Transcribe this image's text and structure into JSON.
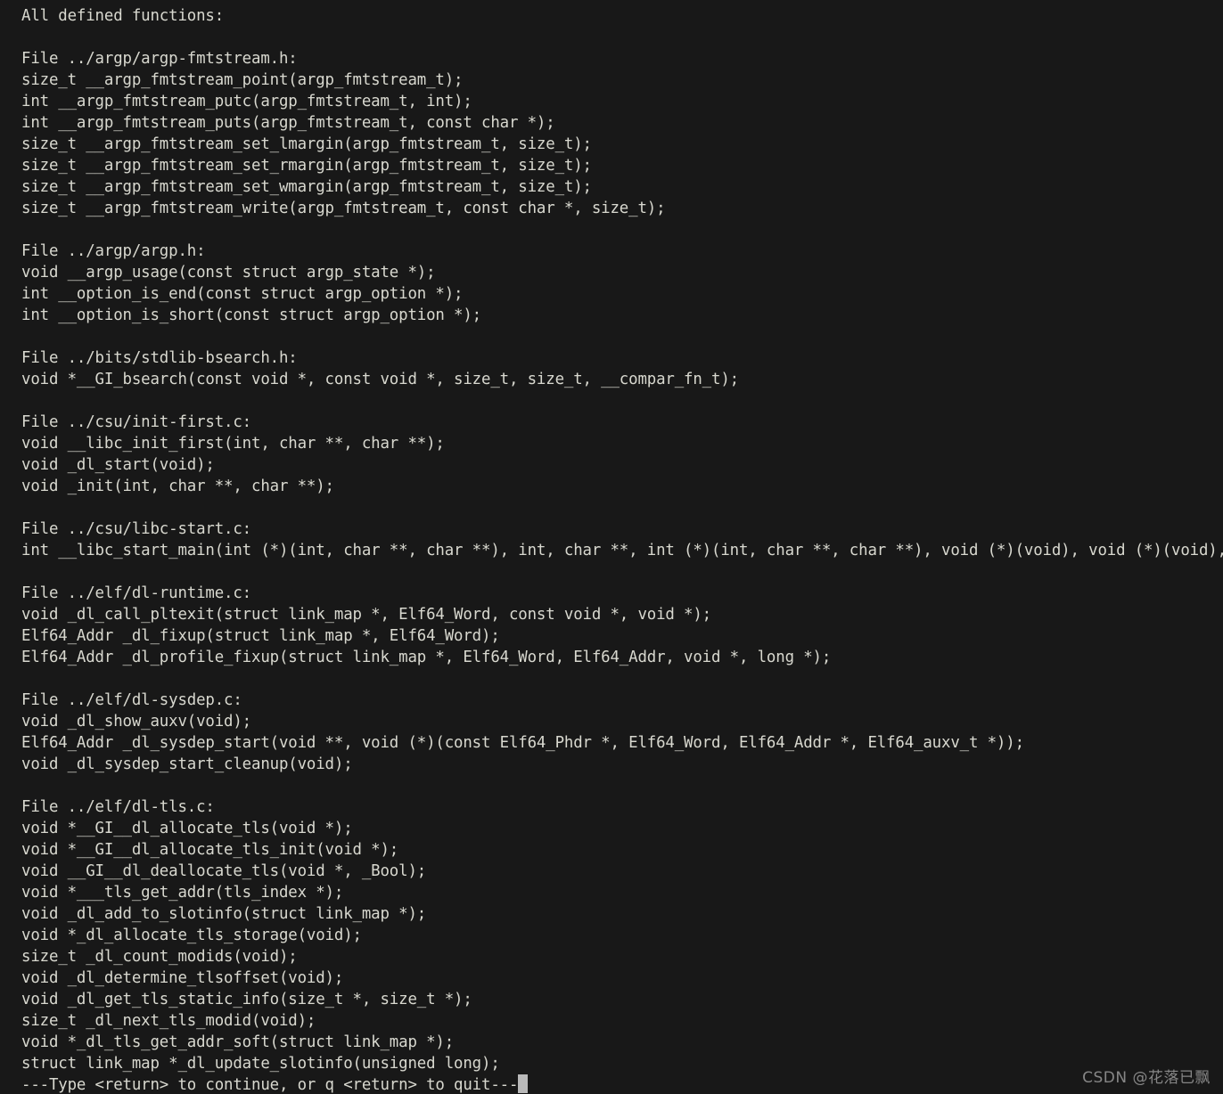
{
  "terminal": {
    "program": "gdb",
    "background_color": "#181818",
    "text_color": "#d8d8cf",
    "cursor_color": "#b9b9b9",
    "header": "All defined functions:",
    "lines": [
      "All defined functions:",
      "",
      "File ../argp/argp-fmtstream.h:",
      "size_t __argp_fmtstream_point(argp_fmtstream_t);",
      "int __argp_fmtstream_putc(argp_fmtstream_t, int);",
      "int __argp_fmtstream_puts(argp_fmtstream_t, const char *);",
      "size_t __argp_fmtstream_set_lmargin(argp_fmtstream_t, size_t);",
      "size_t __argp_fmtstream_set_rmargin(argp_fmtstream_t, size_t);",
      "size_t __argp_fmtstream_set_wmargin(argp_fmtstream_t, size_t);",
      "size_t __argp_fmtstream_write(argp_fmtstream_t, const char *, size_t);",
      "",
      "File ../argp/argp.h:",
      "void __argp_usage(const struct argp_state *);",
      "int __option_is_end(const struct argp_option *);",
      "int __option_is_short(const struct argp_option *);",
      "",
      "File ../bits/stdlib-bsearch.h:",
      "void *__GI_bsearch(const void *, const void *, size_t, size_t, __compar_fn_t);",
      "",
      "File ../csu/init-first.c:",
      "void __libc_init_first(int, char **, char **);",
      "void _dl_start(void);",
      "void _init(int, char **, char **);",
      "",
      "File ../csu/libc-start.c:",
      "int __libc_start_main(int (*)(int, char **, char **), int, char **, int (*)(int, char **, char **), void (*)(void), void (*)(void), void *);",
      "",
      "File ../elf/dl-runtime.c:",
      "void _dl_call_pltexit(struct link_map *, Elf64_Word, const void *, void *);",
      "Elf64_Addr _dl_fixup(struct link_map *, Elf64_Word);",
      "Elf64_Addr _dl_profile_fixup(struct link_map *, Elf64_Word, Elf64_Addr, void *, long *);",
      "",
      "File ../elf/dl-sysdep.c:",
      "void _dl_show_auxv(void);",
      "Elf64_Addr _dl_sysdep_start(void **, void (*)(const Elf64_Phdr *, Elf64_Word, Elf64_Addr *, Elf64_auxv_t *));",
      "void _dl_sysdep_start_cleanup(void);",
      "",
      "File ../elf/dl-tls.c:",
      "void *__GI__dl_allocate_tls(void *);",
      "void *__GI__dl_allocate_tls_init(void *);",
      "void __GI__dl_deallocate_tls(void *, _Bool);",
      "void *___tls_get_addr(tls_index *);",
      "void _dl_add_to_slotinfo(struct link_map *);",
      "void *_dl_allocate_tls_storage(void);",
      "size_t _dl_count_modids(void);",
      "void _dl_determine_tlsoffset(void);",
      "void _dl_get_tls_static_info(size_t *, size_t *);",
      "size_t _dl_next_tls_modid(void);",
      "void *_dl_tls_get_addr_soft(struct link_map *);",
      "struct link_map *_dl_update_slotinfo(unsigned long);"
    ],
    "pager_prompt": "---Type <return> to continue, or q <return> to quit---"
  },
  "watermark": {
    "text": "CSDN @花落已飘"
  }
}
